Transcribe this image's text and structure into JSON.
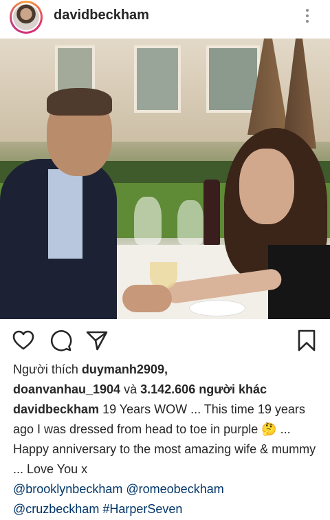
{
  "post": {
    "username": "davidbeckham",
    "liked_by_prefix": "Người thích",
    "liked_by_user1": "duymanh2909,",
    "liked_by_user2": "doanvanhau_1904",
    "liked_by_and": "và",
    "liked_by_count": "3.142.606 người khác",
    "caption_user": "davidbeckham",
    "caption_text_1": "19 Years WOW ... This time 19 years ago I was dressed from head to toe in purple",
    "caption_emoji": "🤔",
    "caption_text_2": "... Happy anniversary to the most amazing wife & mummy ... Love You x",
    "mention_1": "@brooklynbeckham",
    "mention_2": "@romeobeckham",
    "mention_3": "@cruzbeckham",
    "hashtag": "#HarperSeven"
  },
  "icons": {
    "like": "heart-icon",
    "comment": "comment-icon",
    "share": "send-icon",
    "save": "bookmark-icon",
    "more": "more-vertical-icon"
  },
  "colors": {
    "text": "#262626",
    "link": "#003569",
    "icon_gray": "#8e8e8e"
  }
}
